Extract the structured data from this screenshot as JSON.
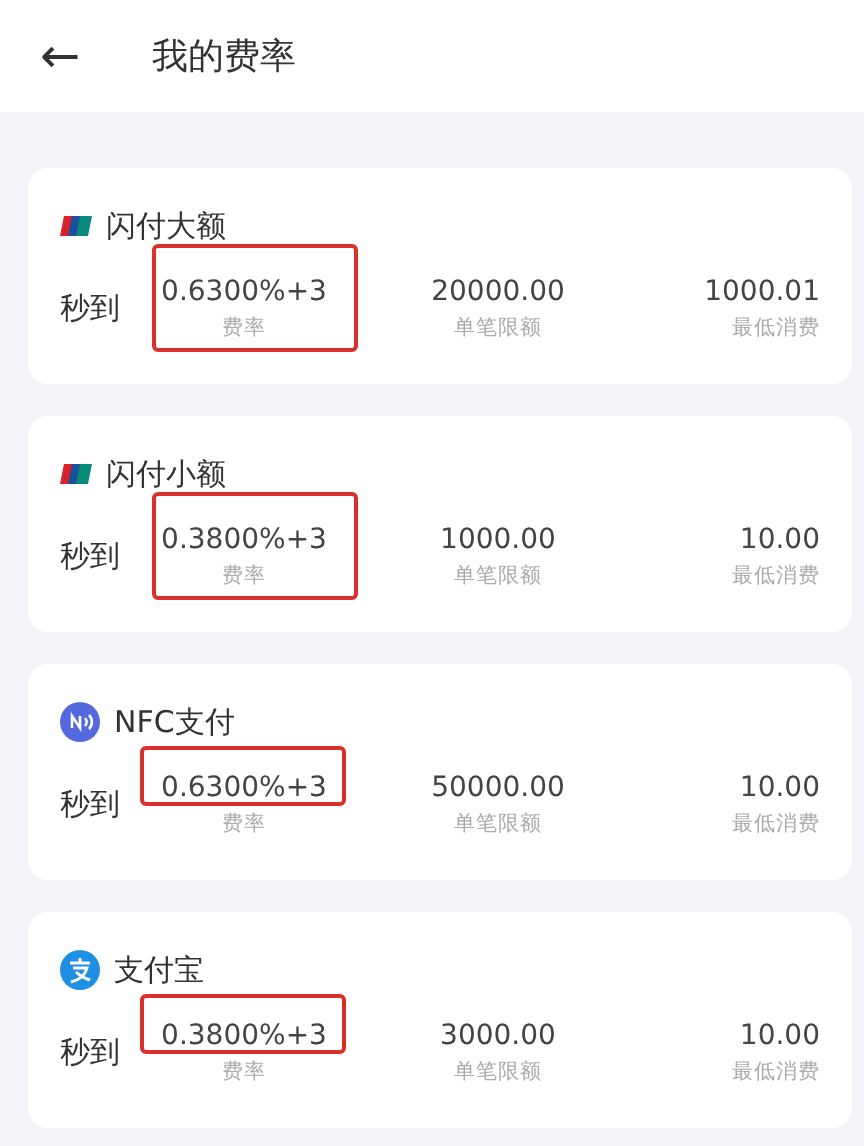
{
  "header": {
    "back": "←",
    "title": "我的费率"
  },
  "cards": [
    {
      "kind": "unionpay",
      "name": "闪付大额",
      "speed": "秒到",
      "rate": "0.6300%+3",
      "rate_label": "费率",
      "limit": "20000.00",
      "limit_label": "单笔限额",
      "minimum": "1000.01",
      "minimum_label": "最低消费",
      "highlighted": true,
      "highlight_includes_label": true
    },
    {
      "kind": "unionpay",
      "name": "闪付小额",
      "speed": "秒到",
      "rate": "0.3800%+3",
      "rate_label": "费率",
      "limit": "1000.00",
      "limit_label": "单笔限额",
      "minimum": "10.00",
      "minimum_label": "最低消费",
      "highlighted": true,
      "highlight_includes_label": true
    },
    {
      "kind": "nfc",
      "name": "NFC支付",
      "speed": "秒到",
      "rate": "0.6300%+3",
      "rate_label": "费率",
      "limit": "50000.00",
      "limit_label": "单笔限额",
      "minimum": "10.00",
      "minimum_label": "最低消费",
      "highlighted": true,
      "highlight_includes_label": false
    },
    {
      "kind": "alipay",
      "name": "支付宝",
      "speed": "秒到",
      "rate": "0.3800%+3",
      "rate_label": "费率",
      "limit": "3000.00",
      "limit_label": "单笔限额",
      "minimum": "10.00",
      "minimum_label": "最低消费",
      "highlighted": true,
      "highlight_includes_label": false
    }
  ]
}
